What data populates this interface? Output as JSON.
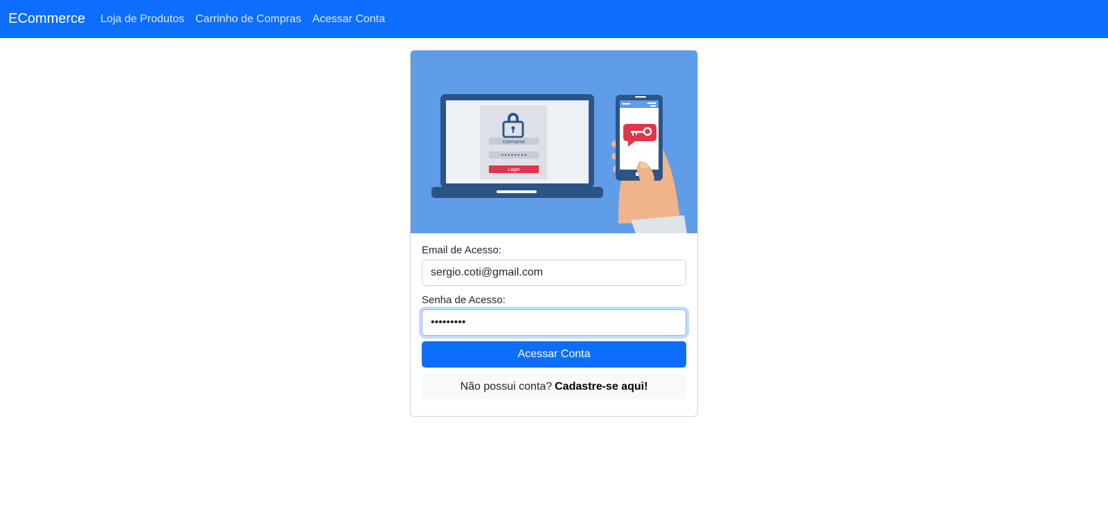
{
  "navbar": {
    "brand": "ECommerce",
    "links": [
      "Loja de Produtos",
      "Carrinho de Compras",
      "Acessar Conta"
    ],
    "color": "#0d6efd"
  },
  "hero": {
    "background": "#5f9de9",
    "username_label": "Username",
    "password_dots": "••••••••",
    "login_label": "Login",
    "icons": [
      "laptop",
      "lock-icon",
      "phone",
      "key-icon",
      "hand"
    ]
  },
  "form": {
    "email_label": "Email de Acesso:",
    "email_value": "sergio.coti@gmail.com",
    "password_label": "Senha de Acesso:",
    "password_value": "•••••••••",
    "submit_label": "Acessar Conta",
    "register_prompt": "Não possui conta?",
    "register_link": "Cadastre-se aqui!"
  }
}
